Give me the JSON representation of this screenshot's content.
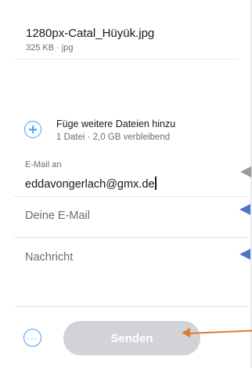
{
  "file": {
    "name": "1280px-Catal_Hüyük.jpg",
    "meta": "325 KB · jpg"
  },
  "add_files": {
    "title": "Füge weitere Dateien hinzu",
    "subtitle": "1 Datei · 2,0 GB verbleibend",
    "icon": "plus-circle-icon"
  },
  "form": {
    "email_to_label": "E-Mail an",
    "email_to_value": "eddavongerlach@gmx.de",
    "your_email_placeholder": "Deine E-Mail",
    "message_placeholder": "Nachricht"
  },
  "footer": {
    "more_icon": "ellipsis-circle-icon",
    "more_glyph": "···",
    "send_label": "Senden"
  },
  "colors": {
    "accent": "#409fff",
    "send_disabled": "#d2d3d6",
    "annotation_blue": "#4a74c8",
    "annotation_gray": "#9a9a9a",
    "annotation_orange": "#e07a2c"
  }
}
